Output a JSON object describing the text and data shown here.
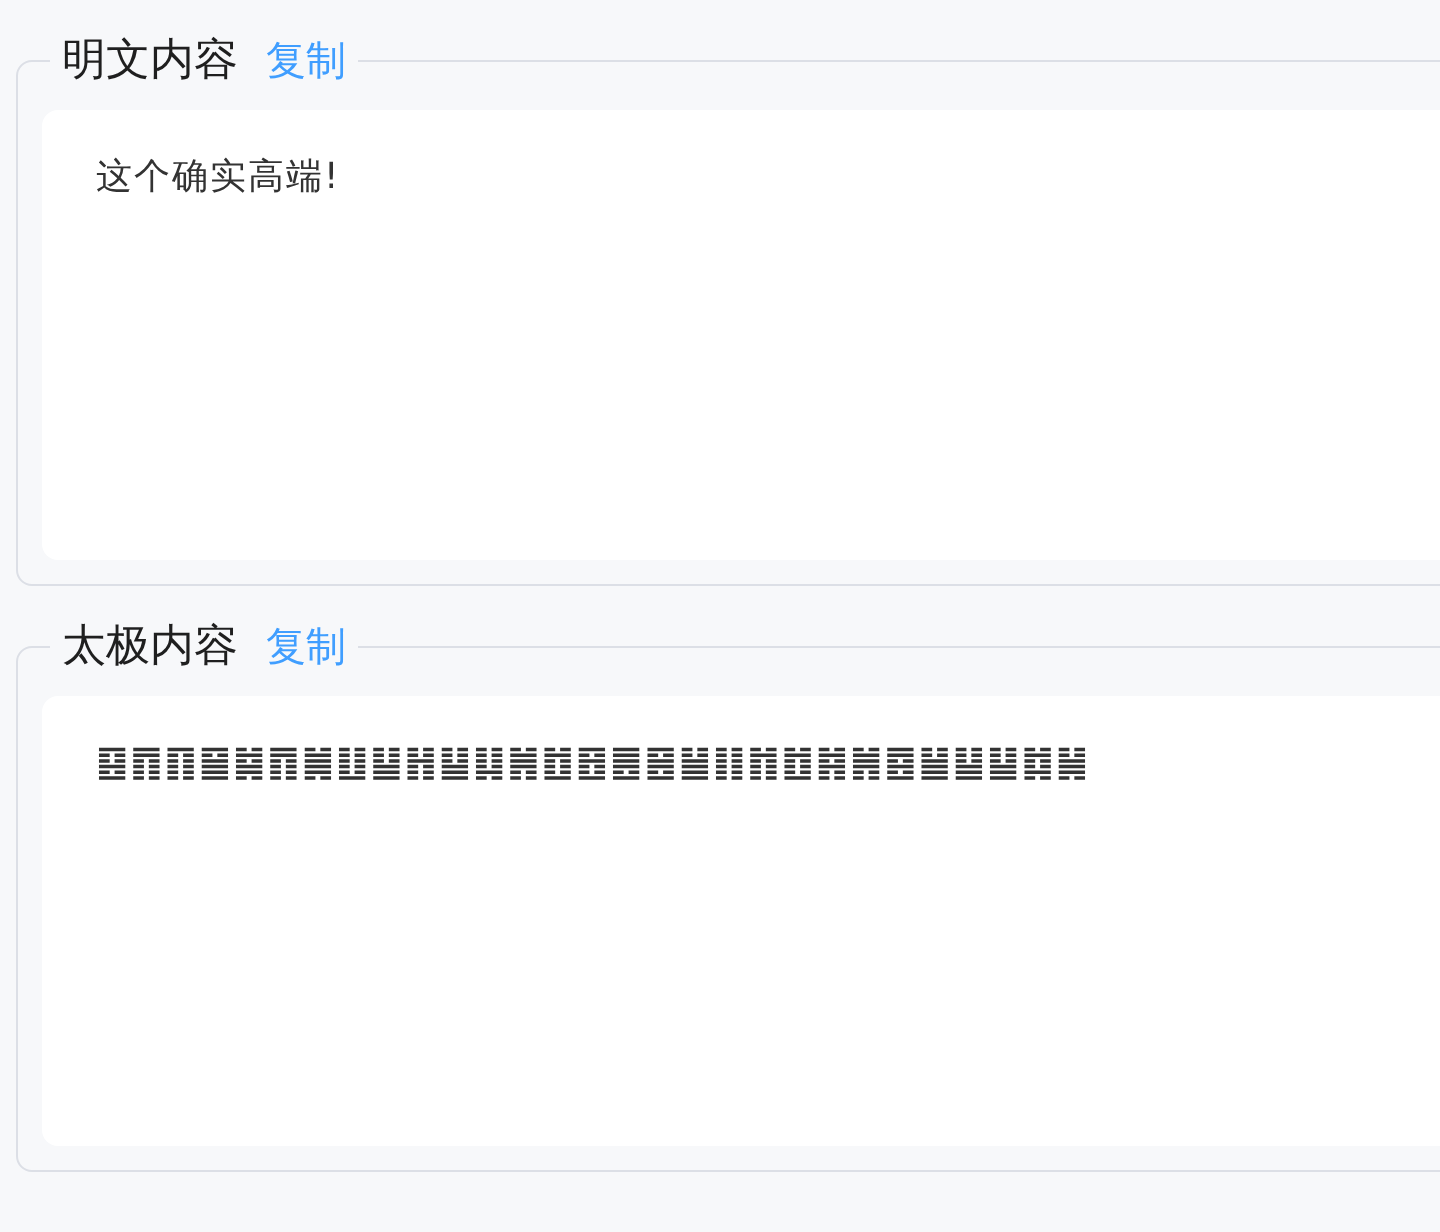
{
  "sections": [
    {
      "title": "明文内容",
      "copy_link": "复制",
      "content": "这个确实高端!"
    },
    {
      "title": "太极内容",
      "copy_link": "复制",
      "content": "䷕䷓䷖䷍䷯䷓䷛䷗䷊䷏䷊䷆䷞䷂䷔䷌䷝䷡䷁䷇䷂䷦䷞䷤䷡䷊䷊䷜䷟"
    }
  ]
}
